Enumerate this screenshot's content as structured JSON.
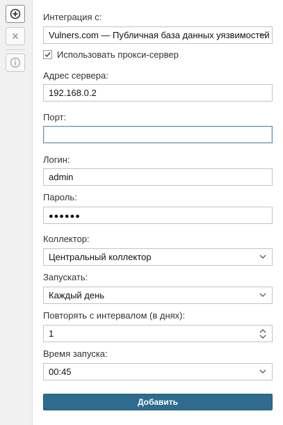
{
  "toolbar": {
    "add_icon": "plus-circle-icon",
    "delete_icon": "close-icon",
    "info_icon": "info-icon"
  },
  "form": {
    "integration_label": "Интеграция с:",
    "integration_value": "Vulners.com — Публичная база данных уязвимостей",
    "use_proxy_label": "Использовать прокси-сервер",
    "use_proxy_checked": true,
    "server_address_label": "Адрес сервера:",
    "server_address_value": "192.168.0.2",
    "port_label": "Порт:",
    "port_value": "",
    "login_label": "Логин:",
    "login_value": "admin",
    "password_label": "Пароль:",
    "password_value": "●●●●●●",
    "collector_label": "Коллектор:",
    "collector_value": "Центральный коллектор",
    "run_label": "Запускать:",
    "run_value": "Каждый день",
    "repeat_label": "Повторять с интервалом (в днях):",
    "repeat_value": "1",
    "start_time_label": "Время запуска:",
    "start_time_value": "00:45",
    "submit_label": "Добавить"
  },
  "colors": {
    "accent": "#2f6b8f",
    "focus_border": "#5c8fb0",
    "toolbar_bg": "#f1f1f1"
  }
}
